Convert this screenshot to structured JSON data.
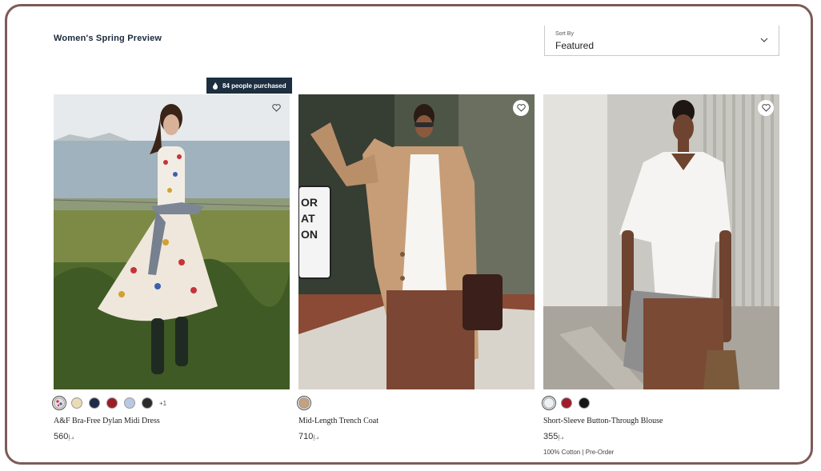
{
  "page": {
    "title": "Women's Spring Preview"
  },
  "sort": {
    "label": "Sort By",
    "value": "Featured"
  },
  "products": [
    {
      "name": "A&F Bra-Free Dylan Midi Dress",
      "price": "560",
      "currency": "د.إ",
      "badge": "84 people purchased",
      "more_colors": "+1",
      "swatches": [
        "#d9c6cc",
        "#eadcb5",
        "#1d2a4a",
        "#9b1d26",
        "#b9c9e3",
        "#2b2b2b"
      ]
    },
    {
      "name": "Mid-Length Trench Coat",
      "price": "710",
      "currency": "د.إ",
      "swatches": [
        "#c2a27f"
      ]
    },
    {
      "name": "Short-Sleeve Button-Through Blouse",
      "price": "355",
      "currency": "د.إ",
      "note": "100% Cotton | Pre-Order",
      "swatches": [
        "#eef1f4",
        "#a11a2a",
        "#161616"
      ]
    }
  ]
}
